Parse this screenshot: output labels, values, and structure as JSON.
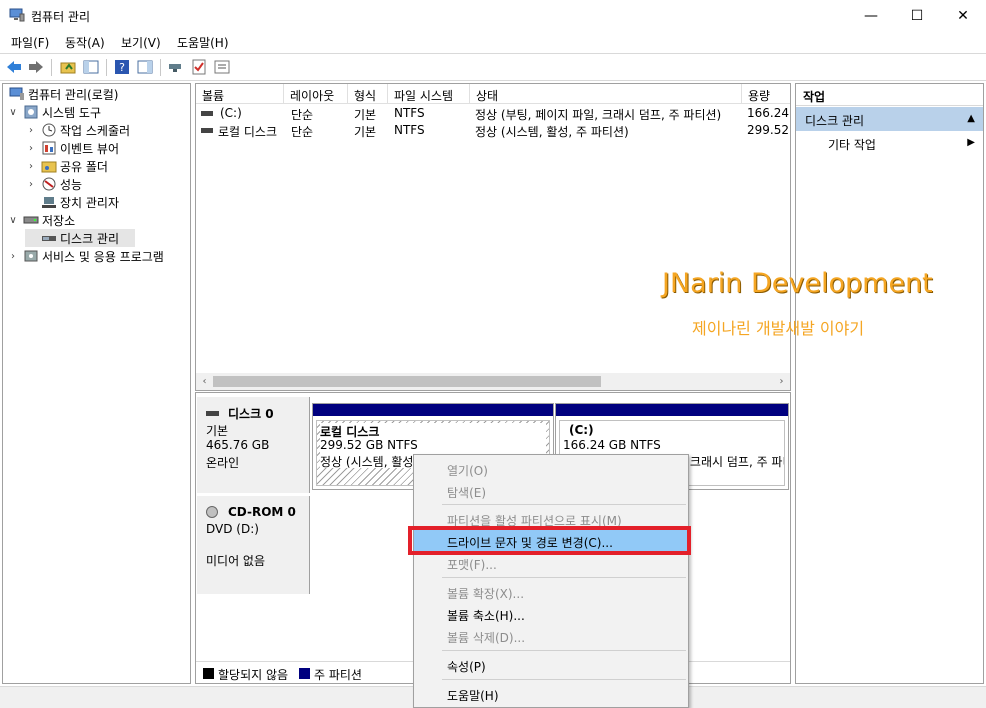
{
  "window": {
    "title": "컴퓨터 관리",
    "minimize": "—",
    "maximize": "☐",
    "close": "✕"
  },
  "menu": [
    "파일(F)",
    "동작(A)",
    "보기(V)",
    "도움말(H)"
  ],
  "tree": [
    {
      "label": "컴퓨터 관리(로컬)",
      "chev": "",
      "icon": "computer-management-icon"
    },
    {
      "label": "시스템 도구",
      "chev": "∨",
      "icon": "system-tools-icon"
    },
    {
      "label": "작업 스케줄러",
      "chev": "›",
      "icon": "task-scheduler-icon"
    },
    {
      "label": "이벤트 뷰어",
      "chev": "›",
      "icon": "event-viewer-icon"
    },
    {
      "label": "공유 폴더",
      "chev": "›",
      "icon": "shared-folders-icon"
    },
    {
      "label": "성능",
      "chev": "›",
      "icon": "performance-icon"
    },
    {
      "label": "장치 관리자",
      "chev": "",
      "icon": "device-manager-icon"
    },
    {
      "label": "저장소",
      "chev": "∨",
      "icon": "storage-icon"
    },
    {
      "label": "디스크 관리",
      "chev": "",
      "icon": "disk-management-icon"
    },
    {
      "label": "서비스 및 응용 프로그램",
      "chev": "›",
      "icon": "services-apps-icon"
    }
  ],
  "volumes": {
    "columns": [
      "볼륨",
      "레이아웃",
      "형식",
      "파일 시스템",
      "상태",
      "용량"
    ],
    "rows": [
      [
        "(C:)",
        "단순",
        "기본",
        "NTFS",
        "정상 (부팅, 페이지 파일, 크래시 덤프, 주 파티션)",
        "166.24"
      ],
      [
        "로컬 디스크",
        "단순",
        "기본",
        "NTFS",
        "정상 (시스템, 활성, 주 파티션)",
        "299.52"
      ]
    ]
  },
  "disks": [
    {
      "name": "디스크 0",
      "lines": [
        "기본",
        "465.76 GB",
        "온라인"
      ]
    },
    {
      "name": "CD-ROM 0",
      "lines": [
        "DVD (D:)",
        "미디어 없음"
      ]
    }
  ],
  "partitions": [
    {
      "name": "로컬 디스크",
      "size": "299.52 GB NTFS",
      "status": "정상 (시스템, 활성, 주 파티션)"
    },
    {
      "name": "(C:)",
      "size": "166.24 GB NTFS",
      "status": "정상 (부팅, 페이지 파일, 크래시 덤프, 주 파티션)"
    }
  ],
  "legend": [
    "할당되지 않음",
    "주 파티션"
  ],
  "actions": {
    "title": "작업",
    "section": "디스크 관리",
    "more": "기타 작업"
  },
  "watermark": {
    "title": "JNarin Development",
    "subtitle": "제이나린 개발새발 이야기"
  },
  "context_menu": [
    {
      "label": "열기(O)",
      "disabled": true
    },
    {
      "label": "탐색(E)",
      "disabled": true
    },
    {
      "label": "파티션을 활성 파티션으로 표시(M)",
      "disabled": true
    },
    {
      "label": "드라이브 문자 및 경로 변경(C)...",
      "disabled": false,
      "hover": true
    },
    {
      "label": "포맷(F)...",
      "disabled": true
    },
    {
      "label": "볼륨 확장(X)...",
      "disabled": true
    },
    {
      "label": "볼륨 축소(H)...",
      "disabled": false
    },
    {
      "label": "볼륨 삭제(D)...",
      "disabled": true
    },
    {
      "label": "속성(P)",
      "disabled": false
    },
    {
      "label": "도움말(H)",
      "disabled": false
    }
  ],
  "colors": {
    "primary_partition": "#00007f",
    "unallocated": "#000000",
    "highlight": "#e3202a",
    "watermark": "#f5a623"
  }
}
